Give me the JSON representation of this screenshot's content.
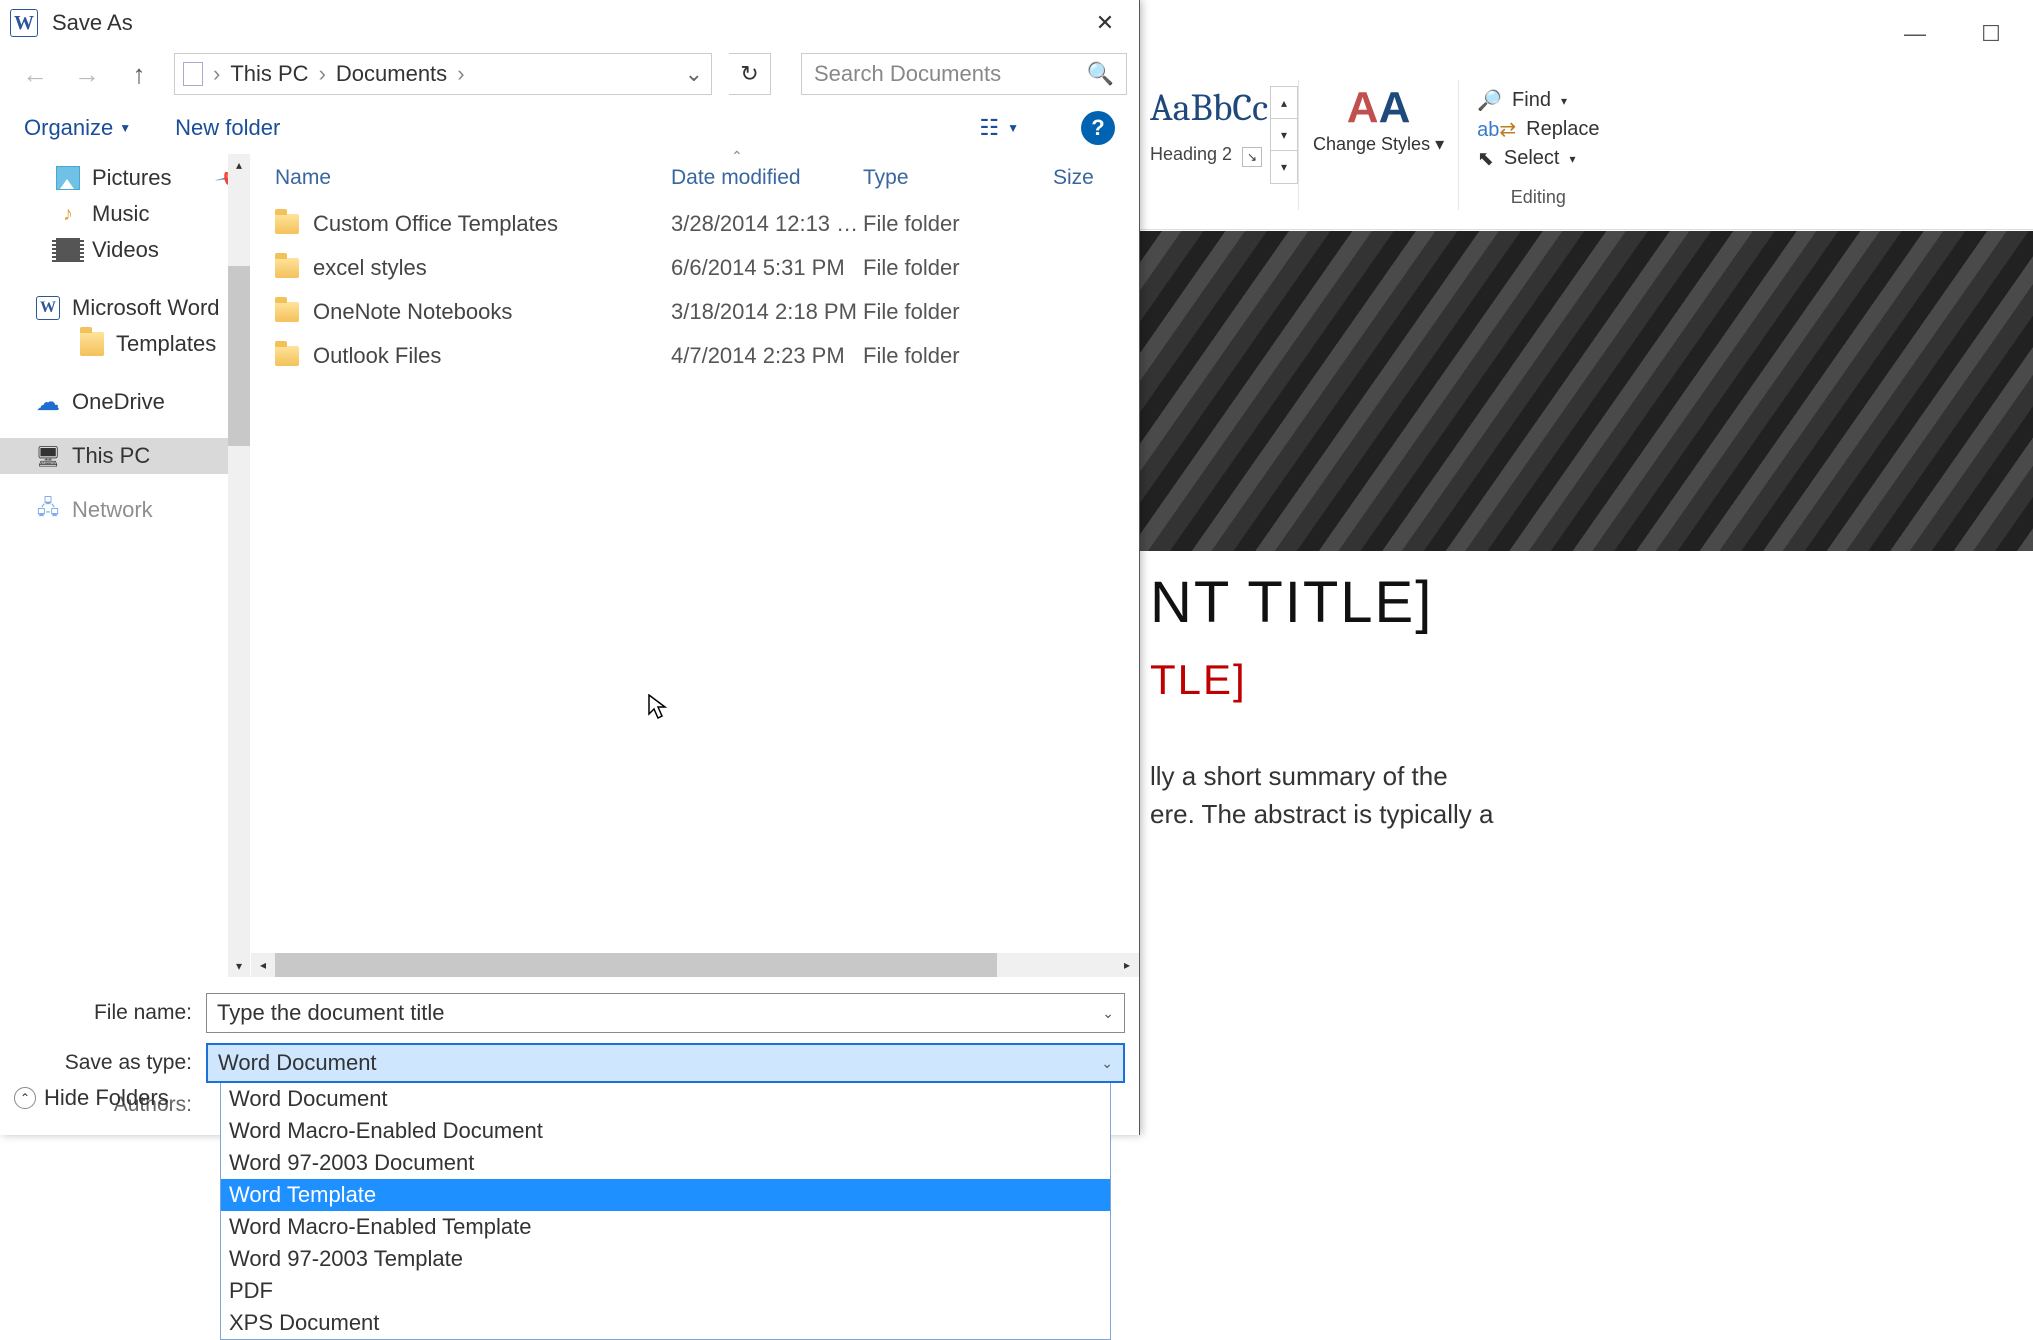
{
  "dialog": {
    "title": "Save As",
    "breadcrumb": {
      "root": "This PC",
      "folder": "Documents"
    },
    "search_placeholder": "Search Documents",
    "organize": "Organize",
    "new_folder": "New folder",
    "columns": {
      "name": "Name",
      "date": "Date modified",
      "type": "Type",
      "size": "Size"
    },
    "nav": {
      "pictures": "Pictures",
      "music": "Music",
      "videos": "Videos",
      "ms_word": "Microsoft Word",
      "templates": "Templates",
      "onedrive": "OneDrive",
      "this_pc": "This PC",
      "network": "Network"
    },
    "files": [
      {
        "name": "Custom Office Templates",
        "date": "3/28/2014 12:13 …",
        "type": "File folder"
      },
      {
        "name": "excel styles",
        "date": "6/6/2014 5:31 PM",
        "type": "File folder"
      },
      {
        "name": "OneNote Notebooks",
        "date": "3/18/2014 2:18 PM",
        "type": "File folder"
      },
      {
        "name": "Outlook Files",
        "date": "4/7/2014 2:23 PM",
        "type": "File folder"
      }
    ],
    "file_name_label": "File name:",
    "file_name_value": "Type the document title",
    "save_type_label": "Save as type:",
    "save_type_value": "Word Document",
    "authors_label": "Authors:",
    "hide_folders": "Hide Folders",
    "type_options": [
      "Word Document",
      "Word Macro-Enabled Document",
      "Word 97-2003 Document",
      "Word Template",
      "Word Macro-Enabled Template",
      "Word 97-2003 Template",
      "PDF",
      "XPS Document"
    ],
    "type_hover_index": 3
  },
  "ribbon": {
    "style_sample": "AaBbCc",
    "style_name": "Heading 2",
    "change_styles": "Change Styles",
    "find": "Find",
    "replace": "Replace",
    "select": "Select",
    "editing": "Editing"
  },
  "doc": {
    "title_fragment": "NT TITLE]",
    "subtitle_fragment": "TLE]",
    "para_line1": "lly a short summary of the",
    "para_line2": "ere. The abstract is typically a"
  }
}
